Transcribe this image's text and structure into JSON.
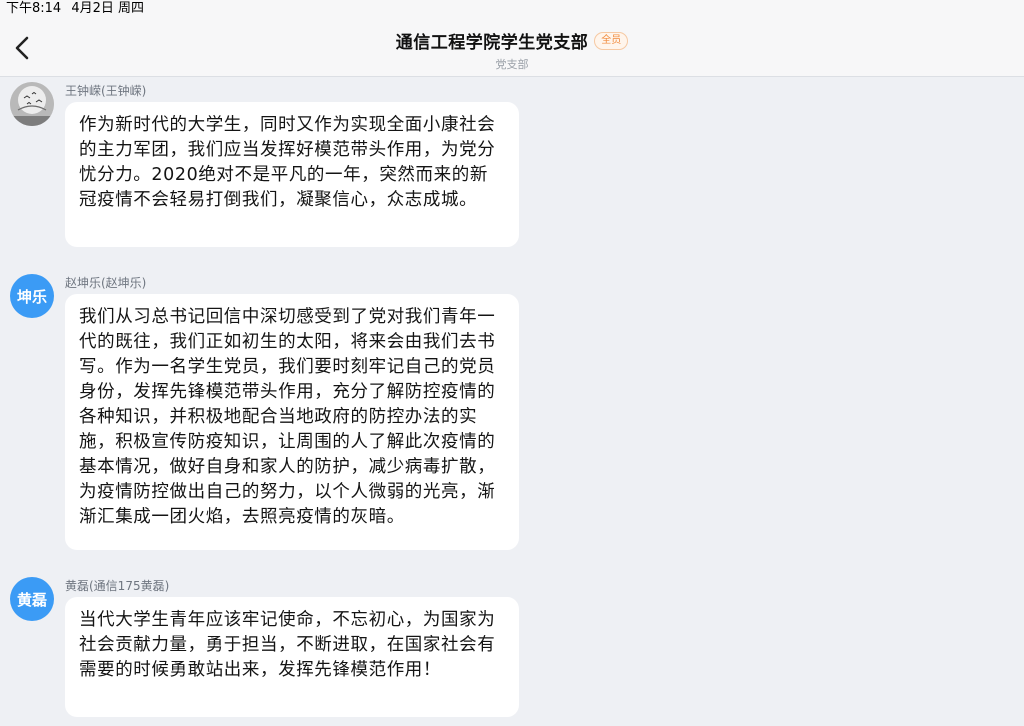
{
  "status_bar": {
    "time": "下午8:14",
    "date": "4月2日 周四"
  },
  "header": {
    "title": "通信工程学院学生党支部",
    "badge": "全员",
    "subtitle": "党支部"
  },
  "messages": [
    {
      "sender": "王钟嵘(王钟嵘)",
      "avatar": {
        "type": "photo",
        "icon": "birds-in-sky-photo"
      },
      "text": "作为新时代的大学生，同时又作为实现全面小康社会的主力军团，我们应当发挥好模范带头作用，为党分忧分力。2020绝对不是平凡的一年，突然而来的新冠疫情不会轻易打倒我们，凝聚信心，众志成城。"
    },
    {
      "sender": "赵坤乐(赵坤乐)",
      "avatar": {
        "type": "text",
        "label": "坤乐",
        "color": "#3b9bf5"
      },
      "text": "我们从习总书记回信中深切感受到了党对我们青年一代的既往，我们正如初生的太阳，将来会由我们去书写。作为一名学生党员，我们要时刻牢记自己的党员身份，发挥先锋模范带头作用，充分了解防控疫情的各种知识，并积极地配合当地政府的防控办法的实施，积极宣传防疫知识，让周围的人了解此次疫情的基本情况，做好自身和家人的防护，减少病毒扩散，为疫情防控做出自己的努力，以个人微弱的光亮，渐渐汇集成一团火焰，去照亮疫情的灰暗。"
    },
    {
      "sender": "黄磊(通信175黄磊)",
      "avatar": {
        "type": "text",
        "label": "黄磊",
        "color": "#3b9bf5"
      },
      "text": "当代大学生青年应该牢记使命，不忘初心，为国家为社会贡献力量，勇于担当，不断进取，在国家社会有需要的时候勇敢站出来，发挥先锋模范作用！"
    }
  ]
}
